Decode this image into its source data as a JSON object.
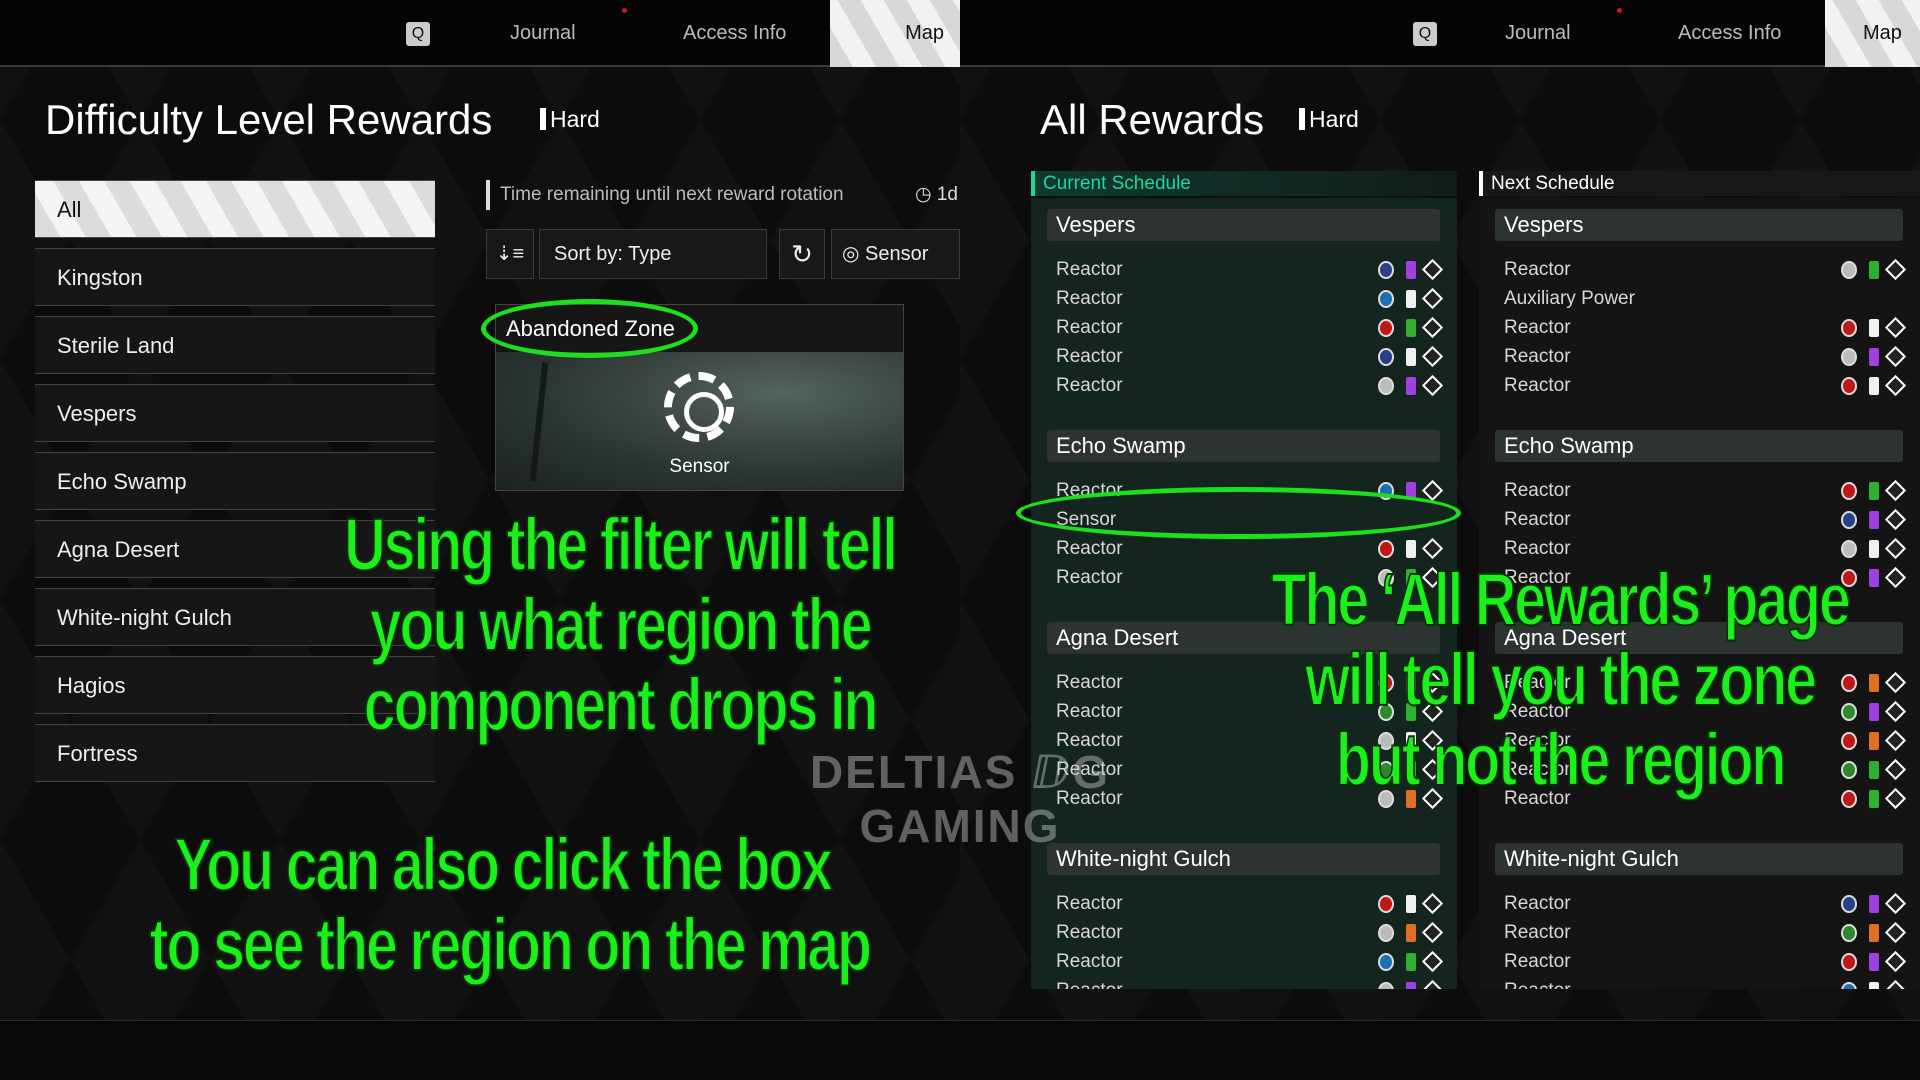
{
  "nav": {
    "q_key": "Q",
    "tabs": [
      "Journal",
      "Access Info",
      "Map"
    ],
    "accent_red": "#d01818"
  },
  "left": {
    "title": "Difficulty Level Rewards",
    "difficulty": "Hard",
    "regions": [
      "All",
      "Kingston",
      "Sterile Land",
      "Vespers",
      "Echo Swamp",
      "Agna Desert",
      "White-night Gulch",
      "Hagios",
      "Fortress"
    ],
    "timer_label": "Time remaining until next reward rotation",
    "timer_value": "1d",
    "sort_label": "Sort by: Type",
    "filter_label": "Sensor",
    "card": {
      "zone": "Abandoned Zone",
      "item": "Sensor"
    }
  },
  "right": {
    "title": "All Rewards",
    "difficulty": "Hard",
    "current_label": "Current Schedule",
    "next_label": "Next Schedule",
    "current": [
      {
        "zone": "Vespers",
        "rows": [
          [
            "Reactor",
            "diamond",
            "purple"
          ],
          [
            "Reactor",
            "lightning",
            "white"
          ],
          [
            "Reactor",
            "fire",
            "green"
          ],
          [
            "Reactor",
            "diamond",
            "white"
          ],
          [
            "Reactor",
            "half",
            "purple"
          ]
        ]
      },
      {
        "zone": "Echo Swamp",
        "rows": [
          [
            "Reactor",
            "lightning",
            "purple"
          ],
          [
            "Sensor",
            "",
            ""
          ],
          [
            "Reactor",
            "fire",
            "white"
          ],
          [
            "Reactor",
            "half",
            "green"
          ]
        ]
      },
      {
        "zone": "Agna Desert",
        "rows": [
          [
            "Reactor",
            "fire",
            "orange"
          ],
          [
            "Reactor",
            "skull",
            "green"
          ],
          [
            "Reactor",
            "half",
            "white"
          ],
          [
            "Reactor",
            "skull",
            "green"
          ],
          [
            "Reactor",
            "half",
            "orange"
          ]
        ]
      },
      {
        "zone": "White-night Gulch",
        "rows": [
          [
            "Reactor",
            "fire",
            "white"
          ],
          [
            "Reactor",
            "half",
            "orange"
          ],
          [
            "Reactor",
            "lightning",
            "green"
          ],
          [
            "Reactor",
            "half",
            "purple"
          ]
        ]
      }
    ],
    "next": [
      {
        "zone": "Vespers",
        "rows": [
          [
            "Reactor",
            "half",
            "green"
          ],
          [
            "Auxiliary Power",
            "",
            ""
          ],
          [
            "Reactor",
            "fire",
            "white"
          ],
          [
            "Reactor",
            "half",
            "purple"
          ],
          [
            "Reactor",
            "fire",
            "white"
          ]
        ]
      },
      {
        "zone": "Echo Swamp",
        "rows": [
          [
            "Reactor",
            "fire",
            "green"
          ],
          [
            "Reactor",
            "diamond",
            "purple"
          ],
          [
            "Reactor",
            "half",
            "white"
          ],
          [
            "Reactor",
            "fire",
            "purple"
          ]
        ]
      },
      {
        "zone": "Agna Desert",
        "rows": [
          [
            "Reactor",
            "fire",
            "orange"
          ],
          [
            "Reactor",
            "skull",
            "purple"
          ],
          [
            "Reactor",
            "fire",
            "orange"
          ],
          [
            "Reactor",
            "skull",
            "green"
          ],
          [
            "Reactor",
            "fire",
            "green"
          ]
        ]
      },
      {
        "zone": "White-night Gulch",
        "rows": [
          [
            "Reactor",
            "diamond",
            "purple"
          ],
          [
            "Reactor",
            "skull",
            "orange"
          ],
          [
            "Reactor",
            "fire",
            "purple"
          ],
          [
            "Reactor",
            "lightning",
            "white"
          ]
        ]
      }
    ],
    "current_color": "#1fd6a0"
  },
  "annotations": {
    "filter": [
      "Using the filter will tell",
      "you what region the",
      "component drops in"
    ],
    "click": [
      "You can also click the box",
      "to see the region on the map"
    ],
    "all_rewards": [
      "The ‘All Rewards’ page",
      "will tell you the zone",
      "but not the region"
    ],
    "color": "#1bf01b"
  },
  "watermark": "DELTIAS DG GAMING"
}
